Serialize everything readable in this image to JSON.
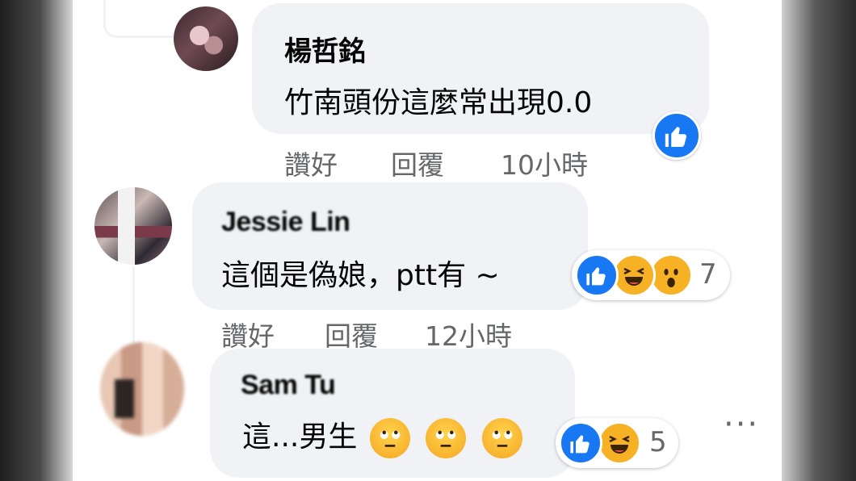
{
  "comments": [
    {
      "author": "楊哲銘",
      "text": "竹南頭份這麼常出現0.0",
      "actions": {
        "like": "讚好",
        "reply": "回覆",
        "time": "10小時"
      },
      "reactions": {
        "icons": [
          "like-icon"
        ],
        "count": ""
      }
    },
    {
      "author": "Jessie Lin",
      "text": "這個是偽娘，ptt有 ~",
      "actions": {
        "like": "讚好",
        "reply": "回覆",
        "time": "12小時"
      },
      "reactions": {
        "icons": [
          "like-icon",
          "haha-icon",
          "wow-icon"
        ],
        "count": "7"
      }
    },
    {
      "author": "Sam Tu",
      "text": "這...男生",
      "text_emojis": [
        "rolling-eyes-icon",
        "rolling-eyes-icon",
        "rolling-eyes-icon"
      ],
      "reactions": {
        "icons": [
          "like-icon",
          "haha-icon"
        ],
        "count": "5"
      }
    }
  ],
  "more_label": "···",
  "colors": {
    "bubble": "#f0f2f5",
    "like": "#1877f2",
    "emoji": "#f7b125",
    "meta_text": "#65676b",
    "text": "#050505"
  }
}
